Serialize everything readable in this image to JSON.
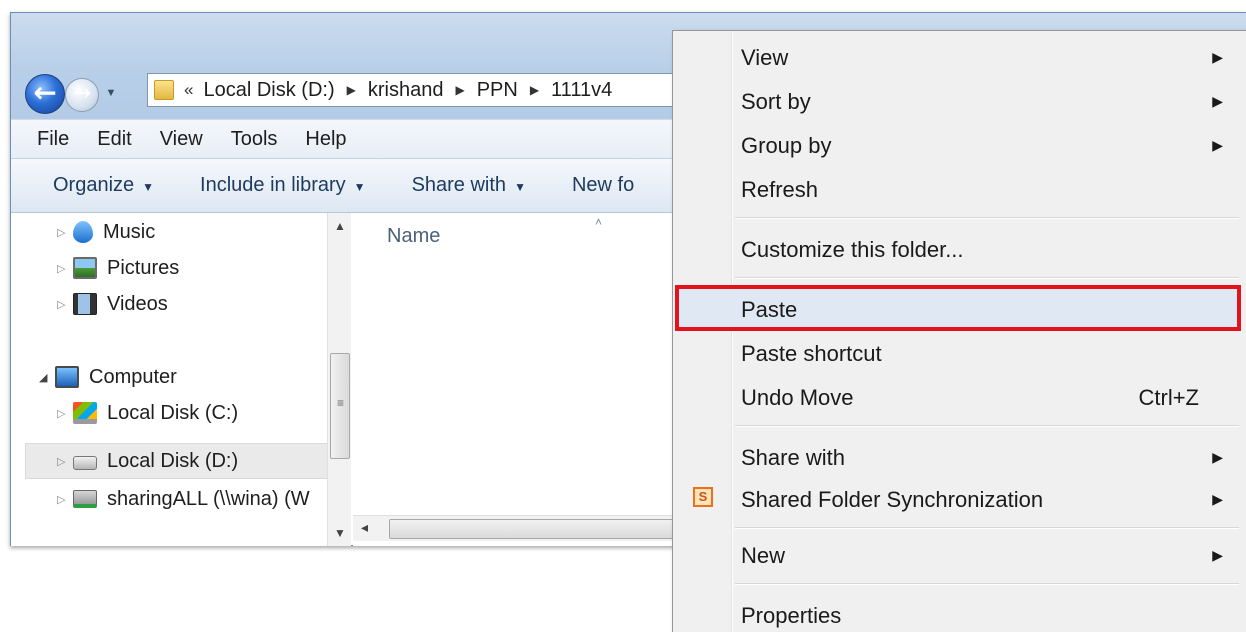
{
  "explorer": {
    "address": {
      "overflow": "«",
      "crumbs": [
        "Local Disk (D:)",
        "krishand",
        "PPN",
        "1111v4"
      ]
    },
    "menu": [
      "File",
      "Edit",
      "View",
      "Tools",
      "Help"
    ],
    "commands": {
      "organize": "Organize",
      "include": "Include in library",
      "share": "Share with",
      "new_folder": "New fo"
    },
    "nav": {
      "music": "Music",
      "pictures": "Pictures",
      "videos": "Videos",
      "computer": "Computer",
      "disk_c": "Local Disk (C:)",
      "disk_d": "Local Disk (D:)",
      "network": "sharingALL (\\\\wina) (W"
    },
    "content": {
      "column_name": "Name"
    }
  },
  "context_menu": {
    "view": "View",
    "sort_by": "Sort by",
    "group_by": "Group by",
    "refresh": "Refresh",
    "customize": "Customize this folder...",
    "paste": "Paste",
    "paste_shortcut": "Paste shortcut",
    "undo_move": "Undo Move",
    "undo_shortcut": "Ctrl+Z",
    "share_with": "Share with",
    "shared_sync": "Shared Folder Synchronization",
    "sync_icon_letter": "S",
    "new": "New",
    "properties": "Properties"
  },
  "colors": {
    "highlight_border": "#e3131e",
    "menu_bg": "#f0f0f0",
    "titlebar": "#b8cfe8"
  }
}
